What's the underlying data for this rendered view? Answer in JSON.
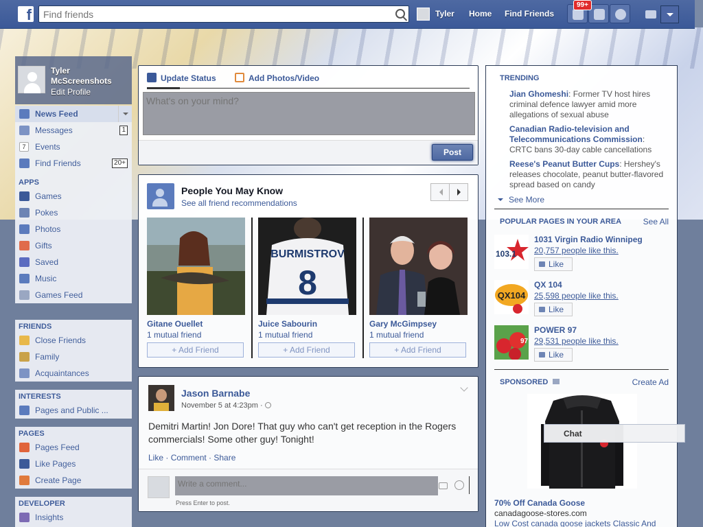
{
  "topbar": {
    "search_placeholder": "Find friends",
    "user_name": "Tyler",
    "home": "Home",
    "find_friends": "Find Friends",
    "notif_badge": "99+"
  },
  "profile": {
    "name": "Tyler McScreenshots",
    "edit": "Edit Profile"
  },
  "favorites": [
    {
      "label": "News Feed",
      "icon_color": "#5b7bbd"
    },
    {
      "label": "Messages",
      "count": "1",
      "icon_color": "#7d93c4"
    },
    {
      "label": "Events",
      "icon_color": "#e0e0e0"
    },
    {
      "label": "Find Friends",
      "count": "20+",
      "icon_color": "#5b7bbd"
    }
  ],
  "apps": {
    "heading": "APPS",
    "items": [
      {
        "label": "Games",
        "icon_color": "#3b5998"
      },
      {
        "label": "Pokes",
        "icon_color": "#6d84b4"
      },
      {
        "label": "Photos",
        "icon_color": "#5b7bbd"
      },
      {
        "label": "Gifts",
        "icon_color": "#e06b4b"
      },
      {
        "label": "Saved",
        "icon_color": "#5b6bc0"
      },
      {
        "label": "Music",
        "icon_color": "#5b7bbd"
      },
      {
        "label": "Games Feed",
        "icon_color": "#9aa7c2"
      }
    ]
  },
  "friends": {
    "heading": "FRIENDS",
    "items": [
      {
        "label": "Close Friends",
        "icon_color": "#e8b84a"
      },
      {
        "label": "Family",
        "icon_color": "#c9a24a"
      },
      {
        "label": "Acquaintances",
        "icon_color": "#7d93c4"
      }
    ]
  },
  "interests": {
    "heading": "INTERESTS",
    "items": [
      {
        "label": "Pages and Public ...",
        "icon_color": "#5b7bbd"
      }
    ]
  },
  "pages": {
    "heading": "PAGES",
    "items": [
      {
        "label": "Pages Feed",
        "icon_color": "#e0643c"
      },
      {
        "label": "Like Pages",
        "icon_color": "#3b5998"
      },
      {
        "label": "Create Page",
        "icon_color": "#e07a3c"
      }
    ]
  },
  "developer": {
    "heading": "DEVELOPER",
    "items": [
      {
        "label": "Insights",
        "icon_color": "#7d6bb4"
      }
    ]
  },
  "composer": {
    "update_status": "Update Status",
    "add_photos": "Add Photos/Video",
    "placeholder": "What's on your mind?",
    "post": "Post"
  },
  "pymk": {
    "title": "People You May Know",
    "subtitle": "See all friend recommendations",
    "add_label": "Add Friend",
    "people": [
      {
        "name": "Gitane Ouellet",
        "mutual": "1 mutual friend"
      },
      {
        "name": "Juice Sabourin",
        "mutual": "1 mutual friend",
        "jersey_name": "BURMISTROV",
        "jersey_number": "8"
      },
      {
        "name": "Gary McGimpsey",
        "mutual": "1 mutual friend"
      }
    ]
  },
  "post": {
    "author": "Jason Barnabe",
    "time": "November 5 at 4:23pm",
    "time_sep": " · ",
    "body": "Demitri Martin! Jon Dore! That guy who can't get reception in the Rogers commercials! Some other guy! Tonight!",
    "like": "Like",
    "comment": "Comment",
    "share": "Share",
    "comment_placeholder": "Write a comment...",
    "hint": "Press Enter to post."
  },
  "trending": {
    "heading": "TRENDING",
    "items": [
      {
        "topic": "Jian Ghomeshi",
        "sep": ": ",
        "text": "Former TV host hires criminal defence lawyer amid more allegations of sexual abuse"
      },
      {
        "topic": "Canadian Radio-television and Telecommunications Commission",
        "sep": ": ",
        "text": "CRTC bans 30-day cable cancellations"
      },
      {
        "topic": "Reese's Peanut Butter Cups",
        "sep": ": ",
        "text": "Hershey's releases chocolate, peanut butter-flavored spread based on candy"
      }
    ],
    "see_more": "See More"
  },
  "popular_pages": {
    "heading": "POPULAR PAGES IN YOUR AREA",
    "see_all": "See All",
    "like_label": "Like",
    "items": [
      {
        "name": "1031 Virgin Radio Winnipeg",
        "likes": "20,757 people like this.",
        "logo_text": "103.1"
      },
      {
        "name": "QX 104",
        "likes": "25,598 people like this.",
        "logo_text": "QX104"
      },
      {
        "name": "POWER 97",
        "likes": "29,531 people like this.",
        "logo_text": "97"
      }
    ]
  },
  "sponsored": {
    "heading": "SPONSORED",
    "create_ad": "Create Ad",
    "title": "70% Off Canada Goose",
    "url": "canadagoose-stores.com",
    "desc": "Low Cost canada goose jackets Classic And"
  },
  "chat": {
    "label": "Chat"
  }
}
